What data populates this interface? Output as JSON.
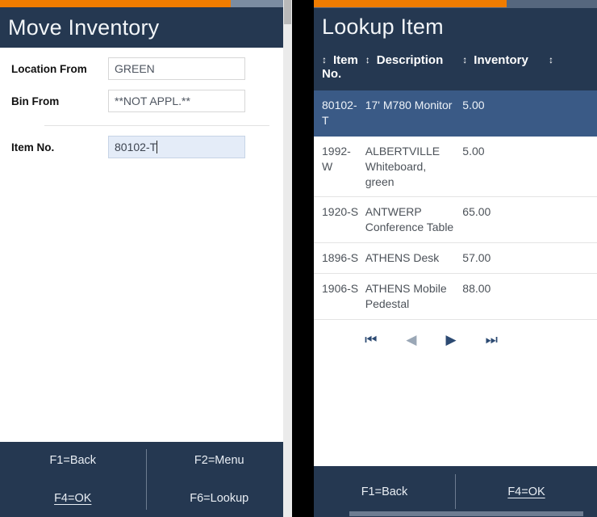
{
  "left_panel": {
    "title": "Move Inventory",
    "progress_percent": 79,
    "fields": [
      {
        "label": "Location From",
        "value": "GREEN",
        "focused": false
      },
      {
        "label": "Bin From",
        "value": "**NOT APPL.**",
        "focused": false
      },
      {
        "label": "Item No.",
        "value": "80102-T",
        "focused": true
      }
    ],
    "footer": {
      "f1": "F1=Back",
      "f2": "F2=Menu",
      "f4": "F4=OK",
      "f6": "F6=Lookup"
    }
  },
  "right_panel": {
    "title": "Lookup Item",
    "progress_percent": 68,
    "table": {
      "sort_icon": "↕",
      "headers": [
        "Item No.",
        "Description",
        "Inventory",
        ""
      ],
      "rows": [
        {
          "item_no": "80102-T",
          "description": "17' M780 Monitor",
          "inventory": "5.00",
          "extra": "",
          "selected": true
        },
        {
          "item_no": "1992-W",
          "description": "ALBERTVILLE Whiteboard, green",
          "inventory": "5.00",
          "extra": "",
          "selected": false
        },
        {
          "item_no": "1920-S",
          "description": "ANTWERP Conference Table",
          "inventory": "65.00",
          "extra": "",
          "selected": false
        },
        {
          "item_no": "1896-S",
          "description": "ATHENS Desk",
          "inventory": "57.00",
          "extra": "",
          "selected": false
        },
        {
          "item_no": "1906-S",
          "description": "ATHENS Mobile Pedestal",
          "inventory": "88.00",
          "extra": "",
          "selected": false
        }
      ]
    },
    "pager": {
      "first": "⏮",
      "prev": "◀",
      "next": "▶",
      "last": "⏭"
    },
    "footer": {
      "f1": "F1=Back",
      "f4": "F4=OK"
    }
  },
  "colors": {
    "header_navy": "#253851",
    "accent_orange": "#f07c00",
    "row_selected": "#3a5a86",
    "field_focus_bg": "#e4ecf8"
  }
}
